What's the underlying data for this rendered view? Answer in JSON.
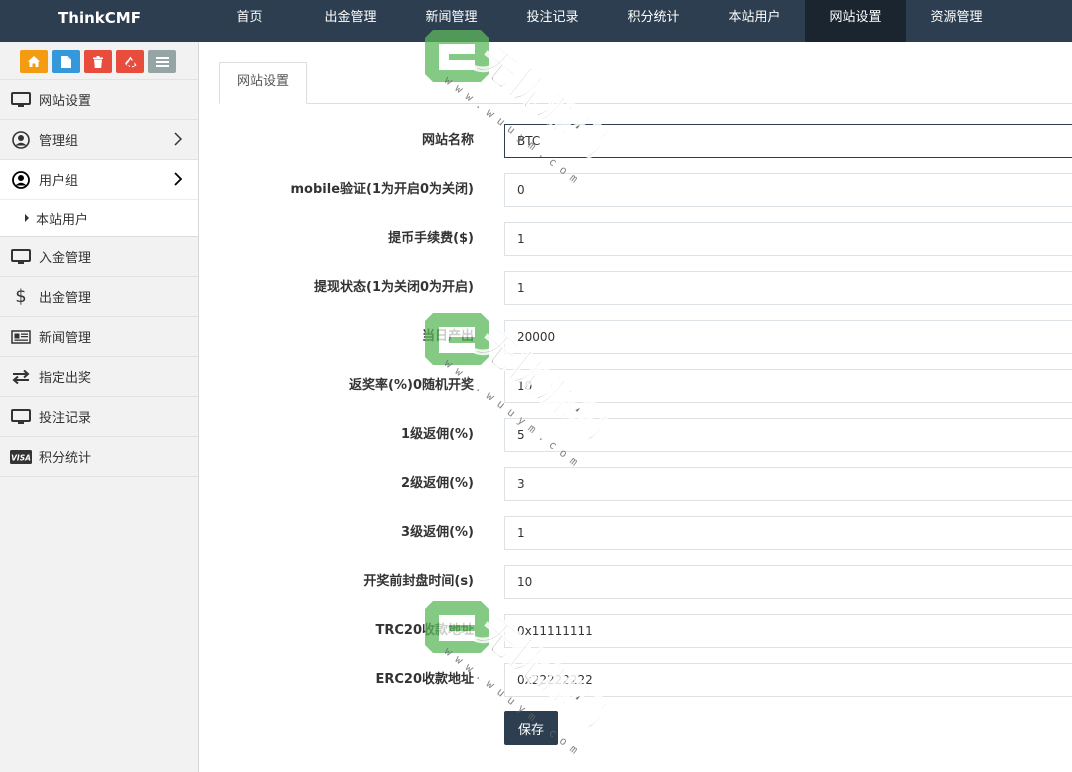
{
  "topbar": {
    "brand": "ThinkCMF",
    "nav": [
      {
        "label": "首页"
      },
      {
        "label": "出金管理"
      },
      {
        "label": "新闻管理"
      },
      {
        "label": "投注记录"
      },
      {
        "label": "积分统计"
      },
      {
        "label": "本站用户"
      },
      {
        "label": "网站设置",
        "active": true
      },
      {
        "label": "资源管理"
      }
    ]
  },
  "shortcuts": [
    {
      "icon": "home-icon",
      "color": "#f39c12"
    },
    {
      "icon": "file-icon",
      "color": "#3498db"
    },
    {
      "icon": "trash-icon",
      "color": "#e74c3c"
    },
    {
      "icon": "recycle-icon",
      "color": "#e74c3c"
    },
    {
      "icon": "list-icon",
      "color": "#95a5a6"
    }
  ],
  "sidebar": {
    "items": [
      {
        "label": "网站设置",
        "icon": "monitor-icon"
      },
      {
        "label": "管理组",
        "icon": "user-circle-icon",
        "has_children": true
      },
      {
        "label": "用户组",
        "icon": "user-circle-icon",
        "has_children": true,
        "open": true
      },
      {
        "label": "本站用户",
        "sub": true
      },
      {
        "label": "入金管理",
        "icon": "monitor-icon"
      },
      {
        "label": "出金管理",
        "icon": "dollar-icon"
      },
      {
        "label": "新闻管理",
        "icon": "newspaper-icon"
      },
      {
        "label": "指定出奖",
        "icon": "exchange-icon"
      },
      {
        "label": "投注记录",
        "icon": "monitor-icon"
      },
      {
        "label": "积分统计",
        "icon": "visa-icon"
      }
    ]
  },
  "tab": {
    "label": "网站设置"
  },
  "form": {
    "fields": [
      {
        "label": "网站名称",
        "value": "BTC"
      },
      {
        "label": "mobile验证(1为开启0为关闭)",
        "value": "0"
      },
      {
        "label": "提币手续费($)",
        "value": "1"
      },
      {
        "label": "提现状态(1为关闭0为开启)",
        "value": "1"
      },
      {
        "label": "当日产出",
        "value": "20000"
      },
      {
        "label": "返奖率(%)0随机开奖",
        "value": "10"
      },
      {
        "label": "1级返佣(%)",
        "value": "5"
      },
      {
        "label": "2级返佣(%)",
        "value": "3"
      },
      {
        "label": "3级返佣(%)",
        "value": "1"
      },
      {
        "label": "开奖前封盘时间(s)",
        "value": "10"
      },
      {
        "label": "TRC20收款地址",
        "value": "0x11111111"
      },
      {
        "label": "ERC20收款地址",
        "value": "0x22222222"
      }
    ],
    "save_label": "保存"
  },
  "watermark": {
    "text": "无忧源码",
    "url": "w w w . w u u y m . c o m",
    "color": "#5cb85c"
  }
}
